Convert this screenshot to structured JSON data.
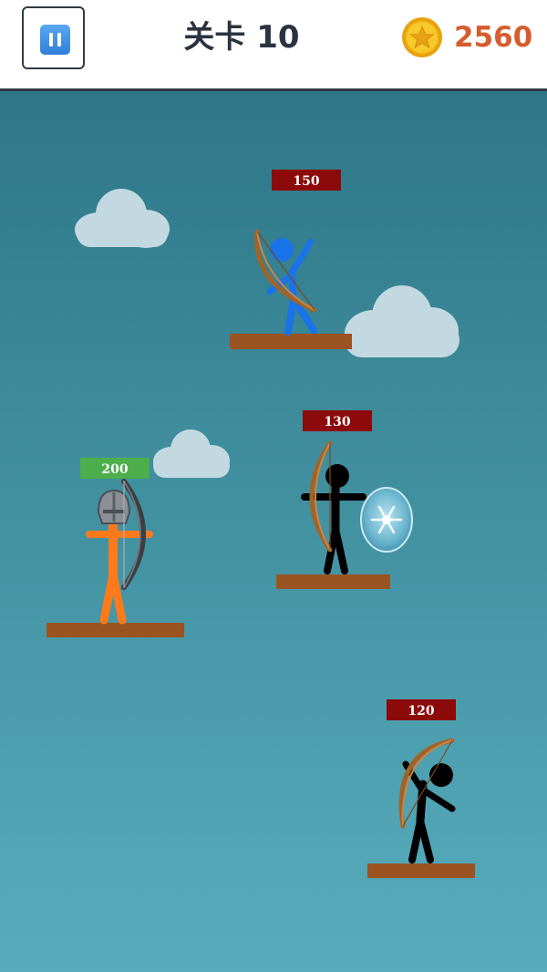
{
  "header": {
    "pause_icon": "pause-icon",
    "level_label": "关卡 10",
    "coin_icon": "star-coin-icon",
    "coins": "2560"
  },
  "player": {
    "health": "200",
    "health_bar_color": "#4cae4c",
    "color": "#ff7a1a",
    "equipment": "helmet"
  },
  "enemies": [
    {
      "health": "150",
      "color": "#1a73e8"
    },
    {
      "health": "130",
      "color": "#000000",
      "shield": "ice-shield"
    },
    {
      "health": "120",
      "color": "#000000"
    }
  ],
  "colors": {
    "sky_top": "#2e7787",
    "sky_bottom": "#57adbd",
    "enemy_health_bar": "#8c0a0a",
    "platform": "#9b5321",
    "cloud": "#c3d9e1"
  }
}
